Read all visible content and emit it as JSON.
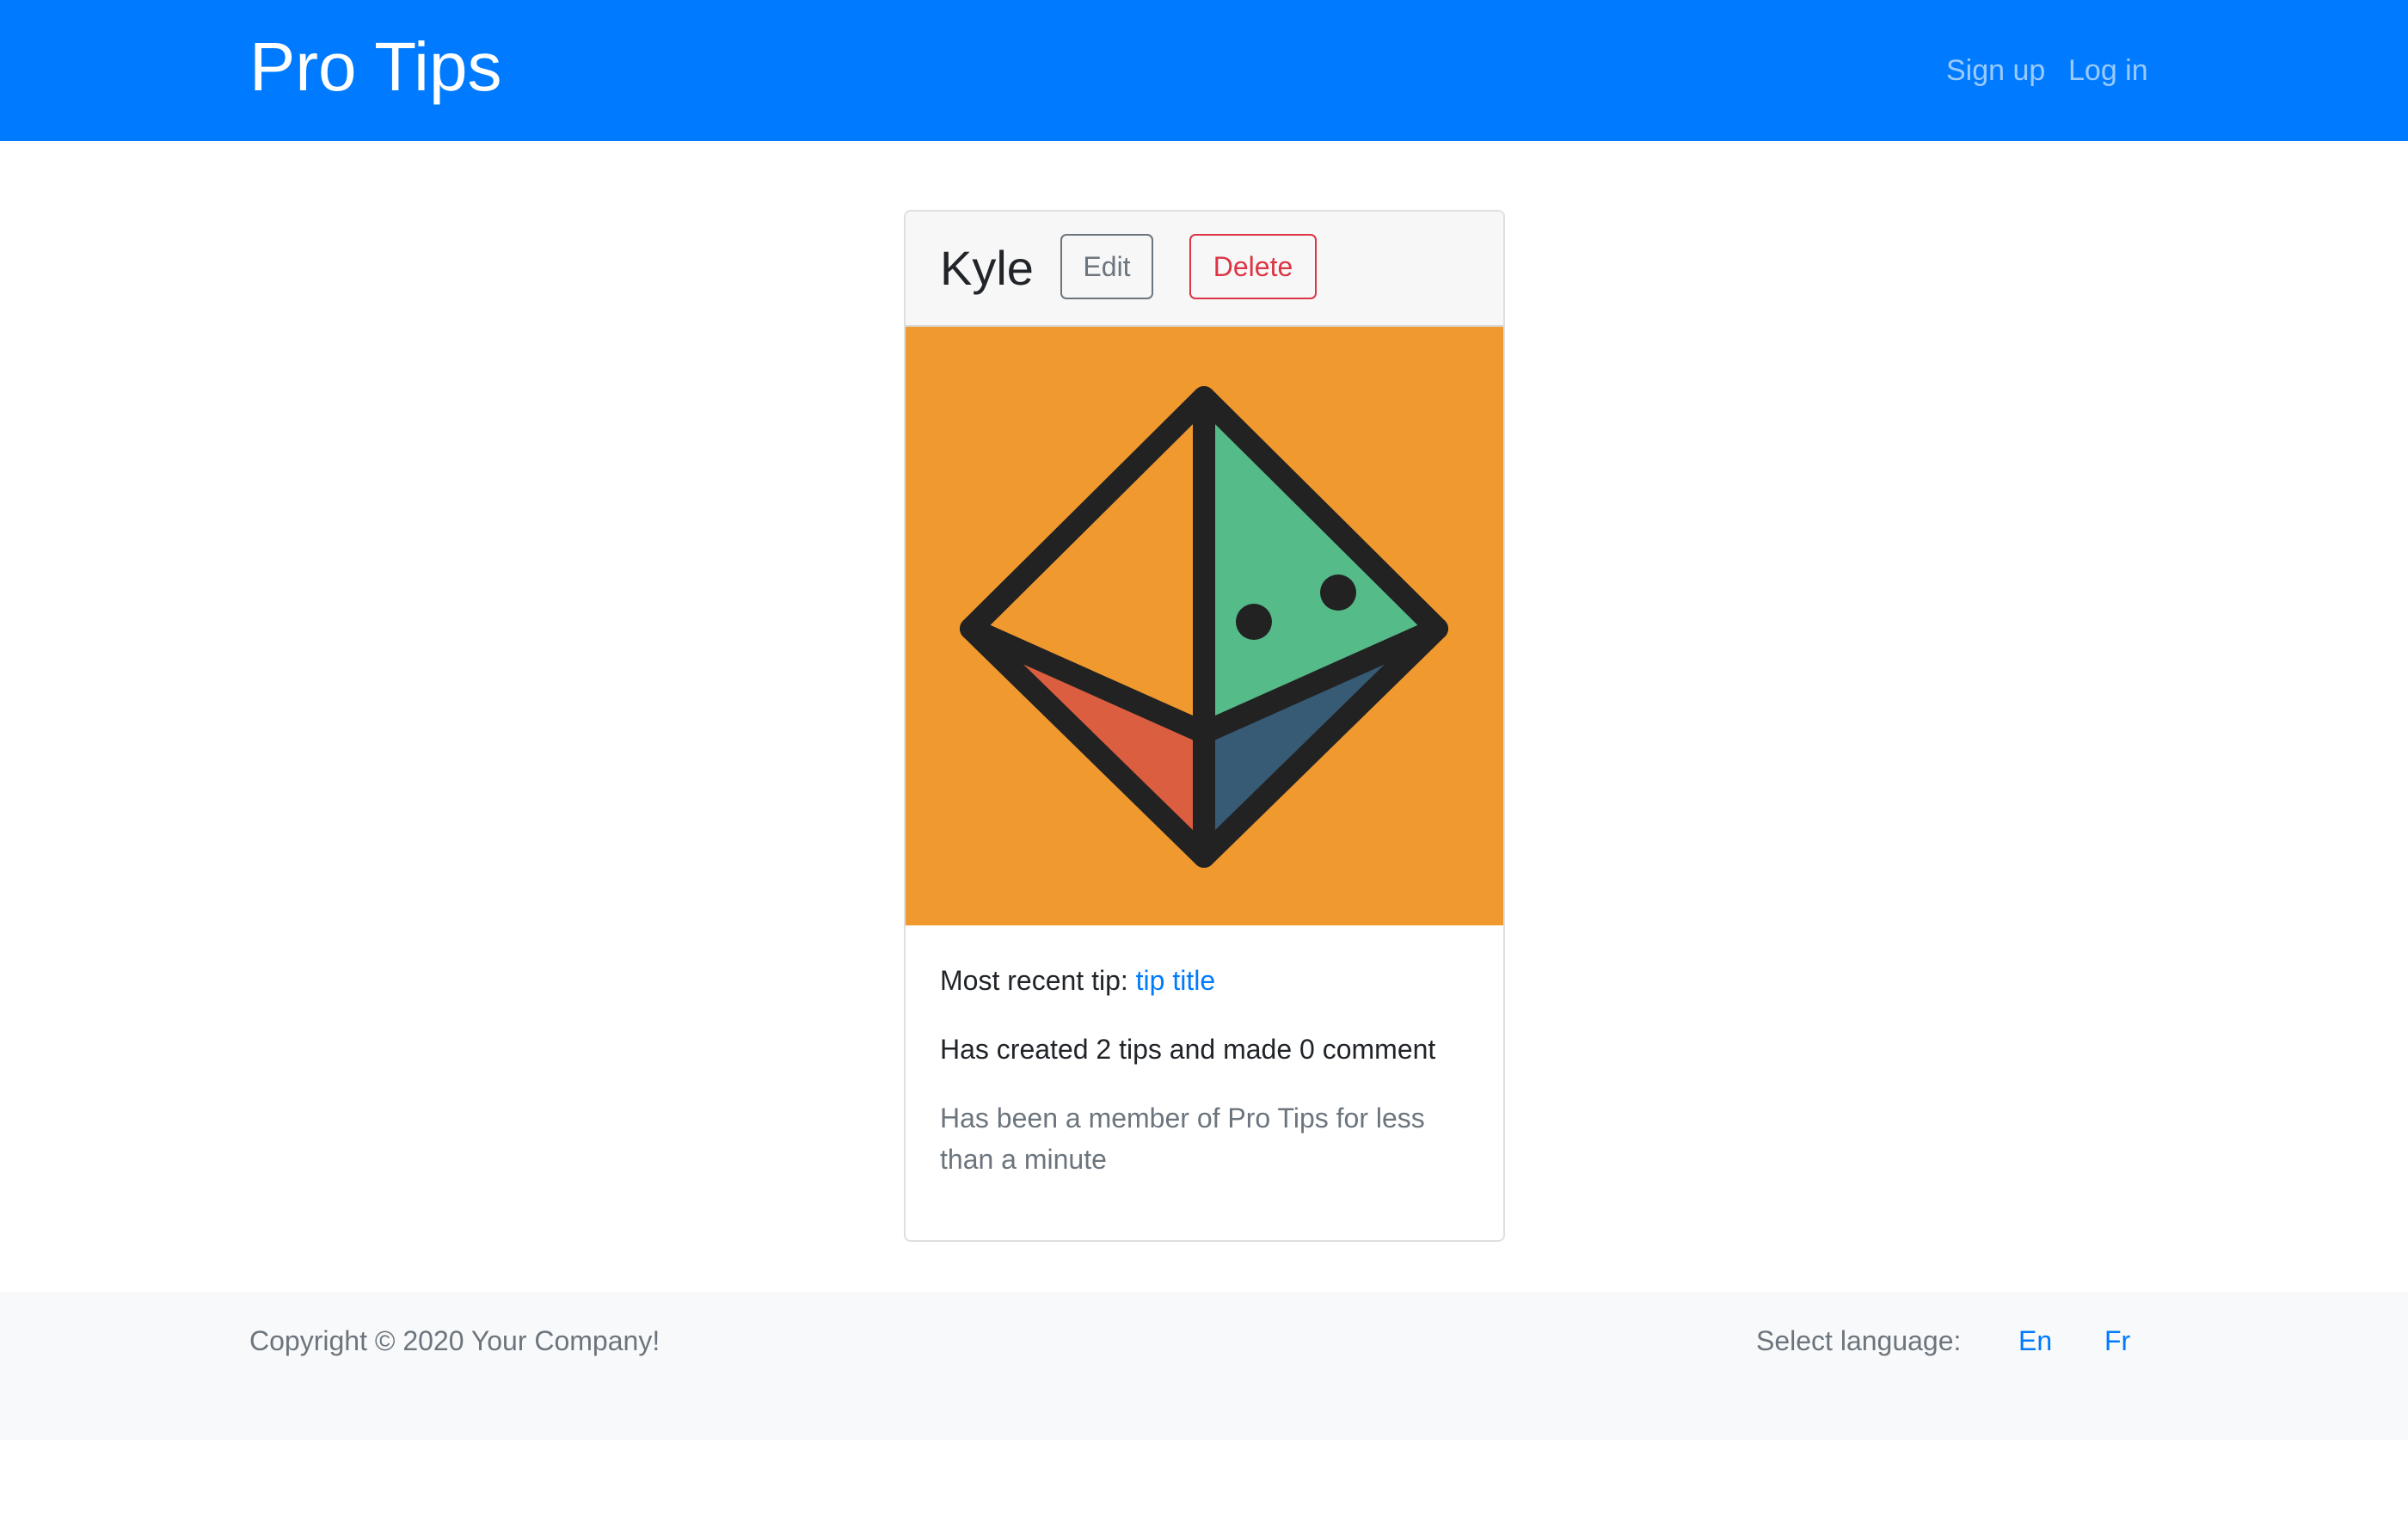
{
  "navbar": {
    "brand": "Pro Tips",
    "links": [
      {
        "label": "Sign up"
      },
      {
        "label": "Log in"
      }
    ]
  },
  "profile": {
    "name": "Kyle",
    "edit_label": "Edit",
    "delete_label": "Delete",
    "avatar": {
      "icon": "octahedron-avatar-icon",
      "background": "#f0992f",
      "colors": {
        "left_top": "#f0992f",
        "right_top": "#55bb88",
        "left_bottom": "#dc5e40",
        "right_bottom": "#375a75",
        "outline": "#222222"
      }
    },
    "recent_tip_label": "Most recent tip: ",
    "recent_tip_link": "tip title",
    "stats": "Has created 2 tips and made 0 comment",
    "membership": "Has been a member of Pro Tips for less than a minute"
  },
  "footer": {
    "copyright": "Copyright © 2020 Your Company!",
    "language_label": "Select language:",
    "languages": [
      {
        "label": "En"
      },
      {
        "label": "Fr"
      }
    ]
  },
  "colors": {
    "primary": "#007bff",
    "danger": "#dc3545",
    "secondary": "#6c757d"
  }
}
